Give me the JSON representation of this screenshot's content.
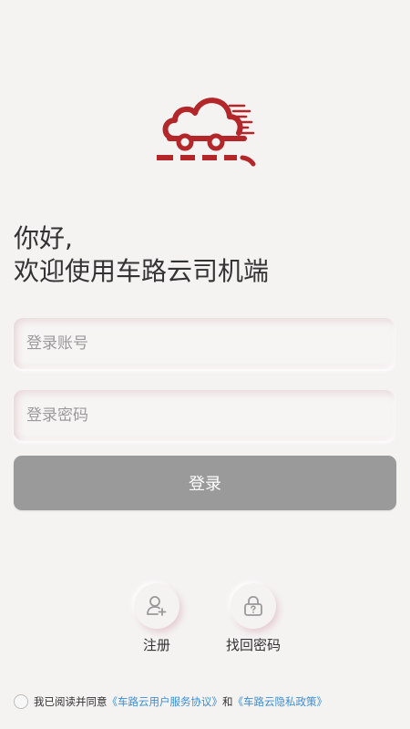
{
  "greeting": {
    "line1": "你好,",
    "line2": "欢迎使用车路云司机端"
  },
  "form": {
    "account_placeholder": "登录账号",
    "account_value": "",
    "password_placeholder": "登录密码",
    "password_value": "",
    "login_label": "登录"
  },
  "actions": {
    "register_label": "注册",
    "find_password_label": "找回密码"
  },
  "agreement": {
    "prefix": "我已阅读并同意",
    "user_agreement": "《车路云用户服务协议》",
    "conjunction": "和",
    "privacy_policy": "《车路云隐私政策》",
    "checked": false
  },
  "icons": {
    "logo": "cloud-car-logo",
    "register": "user-add-icon",
    "find_password": "lock-question-icon"
  },
  "colors": {
    "brand": "#b3262a",
    "background": "#f4f3f2",
    "button": "#9a9a9a",
    "link": "#3a8ed8"
  }
}
